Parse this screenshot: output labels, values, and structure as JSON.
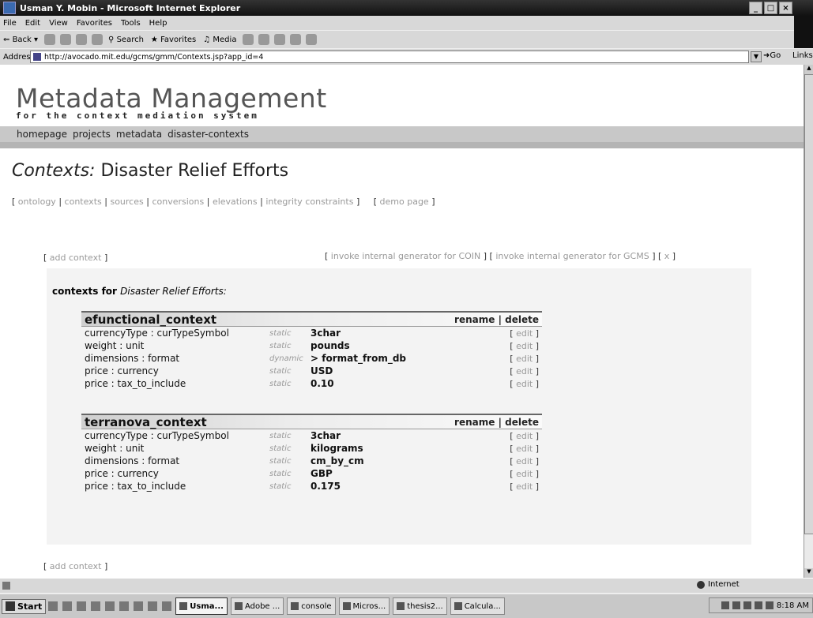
{
  "window": {
    "title": "Usman Y. Mobin - Microsoft Internet Explorer",
    "controls": [
      "_",
      "□",
      "×"
    ]
  },
  "menu": [
    "File",
    "Edit",
    "View",
    "Favorites",
    "Tools",
    "Help"
  ],
  "toolbar": {
    "back": "Back",
    "search": "Search",
    "favorites": "Favorites",
    "media": "Media"
  },
  "address": {
    "label": "Address",
    "url": "http://avocado.mit.edu/gcms/gmm/Contexts.jsp?app_id=4",
    "go": "Go",
    "links": "Links"
  },
  "logo": {
    "title": "Metadata Management",
    "subtitle": "for the context mediation system"
  },
  "nav": [
    "homepage",
    "projects",
    "metadata",
    "disaster-contexts"
  ],
  "page": {
    "title_prefix": "Contexts:",
    "title": "Disaster Relief Efforts"
  },
  "subnav": {
    "items": [
      "ontology",
      "contexts",
      "sources",
      "conversions",
      "elevations",
      "integrity constraints"
    ],
    "demo": "demo page"
  },
  "actions": {
    "add_context": "add context",
    "invoke_coin": "invoke internal generator for COIN",
    "invoke_gcms": "invoke internal generator for GCMS",
    "close": "x"
  },
  "contexts_heading": {
    "prefix": "contexts for",
    "app": "Disaster Relief Efforts:"
  },
  "context_ops": {
    "rename": "rename",
    "delete": "delete",
    "sep": "|"
  },
  "edit_label": "edit",
  "contexts": [
    {
      "name": "efunctional_context",
      "rows": [
        {
          "attr": "currencyType : curTypeSymbol",
          "kind": "static",
          "value": "3char"
        },
        {
          "attr": "weight : unit",
          "kind": "static",
          "value": "pounds"
        },
        {
          "attr": "dimensions : format",
          "kind": "dynamic",
          "value": "> format_from_db"
        },
        {
          "attr": "price : currency",
          "kind": "static",
          "value": "USD"
        },
        {
          "attr": "price : tax_to_include",
          "kind": "static",
          "value": "0.10"
        }
      ]
    },
    {
      "name": "terranova_context",
      "rows": [
        {
          "attr": "currencyType : curTypeSymbol",
          "kind": "static",
          "value": "3char"
        },
        {
          "attr": "weight : unit",
          "kind": "static",
          "value": "kilograms"
        },
        {
          "attr": "dimensions : format",
          "kind": "static",
          "value": "cm_by_cm"
        },
        {
          "attr": "price : currency",
          "kind": "static",
          "value": "GBP"
        },
        {
          "attr": "price : tax_to_include",
          "kind": "static",
          "value": "0.175"
        }
      ]
    }
  ],
  "status": {
    "zone": "Internet"
  },
  "taskbar": {
    "start": "Start",
    "tasks": [
      "Usma...",
      "Adobe ...",
      "console",
      "Micros...",
      "thesis2...",
      "Calcula..."
    ],
    "clock": "8:18 AM"
  }
}
